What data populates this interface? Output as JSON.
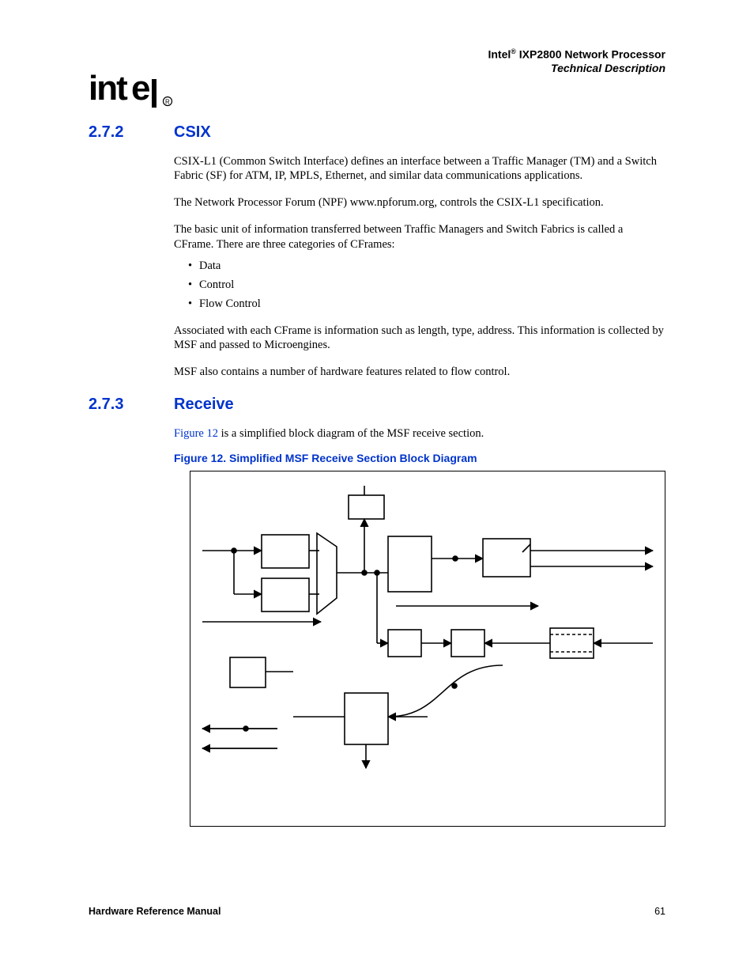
{
  "header": {
    "brand": "Intel",
    "reg": "®",
    "product": " IXP2800 Network Processor",
    "subtitle": "Technical Description"
  },
  "section1": {
    "num": "2.7.2",
    "title": "CSIX",
    "p1": "CSIX-L1 (Common Switch Interface) defines an interface between a Traffic Manager (TM) and a Switch Fabric (SF) for ATM, IP, MPLS, Ethernet, and similar data communications applications.",
    "p2": "The Network Processor Forum (NPF) www.npforum.org, controls the CSIX-L1 specification.",
    "p3": "The basic unit of information transferred between Traffic Managers and Switch Fabrics is called a CFrame. There are three categories of CFrames:",
    "bullets": [
      "Data",
      "Control",
      "Flow Control"
    ],
    "p4": "Associated with each CFrame is information such as length, type, address. This information is collected by MSF and passed to Microengines.",
    "p5": "MSF also contains a number of hardware features related to flow control."
  },
  "section2": {
    "num": "2.7.3",
    "title": "Receive",
    "p1a": "Figure 12",
    "p1b": " is a simplified block diagram of the MSF receive section.",
    "figcap": "Figure 12. Simplified MSF Receive Section Block Diagram"
  },
  "footer": {
    "left": "Hardware Reference Manual",
    "right": "61"
  }
}
